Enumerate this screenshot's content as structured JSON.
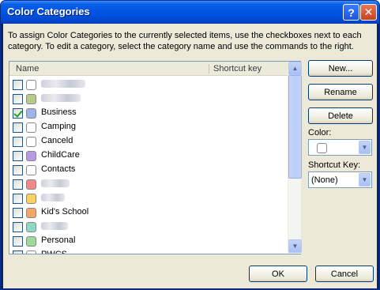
{
  "window": {
    "title": "Color Categories",
    "help_glyph": "?",
    "close_glyph": "✕"
  },
  "instructions": "To assign Color Categories to the currently selected items, use the checkboxes next to each category.  To edit a category, select the category name and use the commands to the right.",
  "list": {
    "header_name": "Name",
    "header_shortcut": "Shortcut key",
    "items": [
      {
        "label": "",
        "checked": false,
        "color": "#ffffff",
        "obscured": true
      },
      {
        "label": "",
        "checked": false,
        "color": "#b7c98c",
        "obscured": true
      },
      {
        "label": "Business",
        "checked": true,
        "color": "#9eb3e8",
        "obscured": false
      },
      {
        "label": "Camping",
        "checked": false,
        "color": "#ffffff",
        "obscured": false
      },
      {
        "label": "Canceld",
        "checked": false,
        "color": "#ffffff",
        "obscured": false
      },
      {
        "label": "ChildCare",
        "checked": false,
        "color": "#b79be0",
        "obscured": false
      },
      {
        "label": "Contacts",
        "checked": false,
        "color": "#ffffff",
        "obscured": false
      },
      {
        "label": "",
        "checked": false,
        "color": "#f08a8a",
        "obscured": true
      },
      {
        "label": "",
        "checked": false,
        "color": "#f8d264",
        "obscured": true
      },
      {
        "label": "Kid's School",
        "checked": false,
        "color": "#f3a56a",
        "obscured": false
      },
      {
        "label": "",
        "checked": false,
        "color": "#8fd6c4",
        "obscured": true
      },
      {
        "label": "Personal",
        "checked": false,
        "color": "#9fd89a",
        "obscured": false
      },
      {
        "label": "PWCS",
        "checked": false,
        "color": "#ffffff",
        "obscured": false
      }
    ]
  },
  "buttons": {
    "new": "New...",
    "rename": "Rename",
    "delete": "Delete",
    "ok": "OK",
    "cancel": "Cancel"
  },
  "color_label": "Color:",
  "shortcut_label": "Shortcut Key:",
  "shortcut_value": "(None)",
  "icons": {
    "scroll_up": "up-arrow-icon",
    "scroll_down": "down-arrow-icon",
    "dropdown": "chevron-down-icon"
  }
}
